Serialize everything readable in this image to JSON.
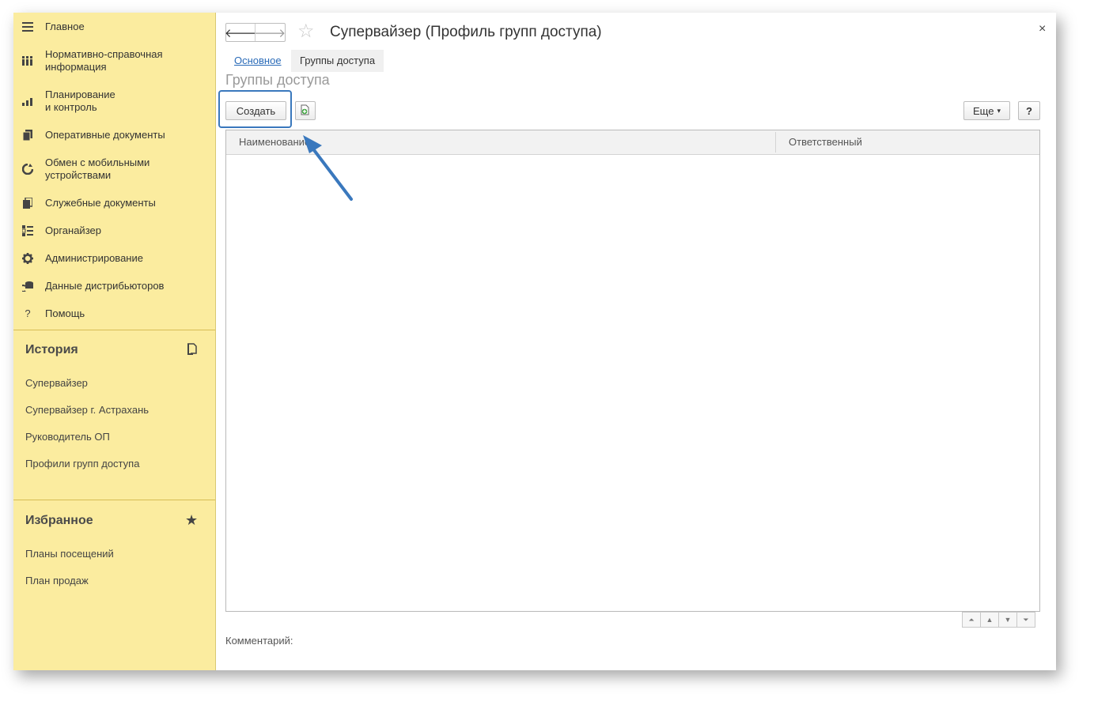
{
  "sidebar": {
    "items": [
      {
        "label": "Главное",
        "icon": "menu-icon"
      },
      {
        "label": "Нормативно-справочная\nинформация",
        "icon": "catalog-icon"
      },
      {
        "label": "Планирование\nи контроль",
        "icon": "chart-icon"
      },
      {
        "label": "Оперативные документы",
        "icon": "documents-icon"
      },
      {
        "label": "Обмен с мобильными\nустройствами",
        "icon": "sync-icon"
      },
      {
        "label": "Служебные документы",
        "icon": "service-documents-icon"
      },
      {
        "label": "Органайзер",
        "icon": "checklist-icon"
      },
      {
        "label": "Администрирование",
        "icon": "gear-icon"
      },
      {
        "label": "Данные дистрибьюторов",
        "icon": "database-icon"
      },
      {
        "label": "Помощь",
        "icon": "help-icon",
        "glyph": "?"
      }
    ],
    "history": {
      "title": "История",
      "items": [
        "Супервайзер",
        "Супервайзер г. Астрахань",
        "Руководитель ОП",
        "Профили групп доступа"
      ]
    },
    "favorites": {
      "title": "Избранное",
      "star": "★",
      "items": [
        "Планы посещений",
        "План продаж"
      ]
    }
  },
  "header": {
    "back_glyph": "🡐",
    "forward_glyph": "🡒",
    "star_glyph": "☆",
    "title": "Супервайзер (Профиль групп доступа)",
    "close_glyph": "×"
  },
  "tabs": {
    "main": "Основное",
    "groups": "Группы доступа"
  },
  "page": {
    "heading": "Группы доступа",
    "create_button": "Создать",
    "more_button": "Еще",
    "more_arrow": "▾",
    "help_button": "?",
    "comment_label": "Комментарий:"
  },
  "table": {
    "columns": [
      "Наименование",
      "Ответственный"
    ]
  },
  "scroll": [
    "⏶",
    "▲",
    "▼",
    "⏷"
  ],
  "colors": {
    "sidebar_bg": "#fbec9f",
    "accent": "#3a78bd",
    "link": "#2a6bb8"
  }
}
